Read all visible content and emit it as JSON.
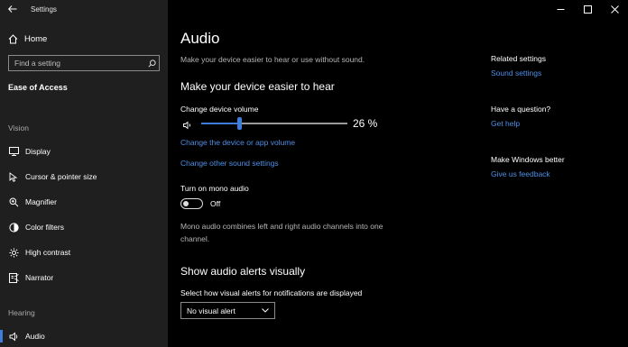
{
  "window": {
    "title": "Settings"
  },
  "sidebar": {
    "home_label": "Home",
    "search_placeholder": "Find a setting",
    "section_title": "Ease of Access",
    "groups": {
      "vision": "Vision",
      "hearing": "Hearing"
    },
    "items": [
      {
        "label": "Display",
        "icon": "monitor-icon"
      },
      {
        "label": "Cursor & pointer size",
        "icon": "cursor-icon"
      },
      {
        "label": "Magnifier",
        "icon": "magnifier-icon"
      },
      {
        "label": "Color filters",
        "icon": "color-filter-icon"
      },
      {
        "label": "High contrast",
        "icon": "contrast-icon"
      },
      {
        "label": "Narrator",
        "icon": "narrator-icon"
      },
      {
        "label": "Audio",
        "icon": "speaker-icon",
        "active": true
      }
    ]
  },
  "main": {
    "title": "Audio",
    "subtitle": "Make your device easier to hear or use without sound.",
    "section1_heading": "Make your device easier to hear",
    "volume_label": "Change device volume",
    "volume": {
      "value": 26,
      "display": "26 %"
    },
    "link_app_volume": "Change the device or app volume",
    "link_sound_settings": "Change other sound settings",
    "mono_label": "Turn on mono audio",
    "mono_state": "Off",
    "mono_description": "Mono audio combines left and right audio channels into one channel.",
    "section2_heading": "Show audio alerts visually",
    "alerts_label": "Select how visual alerts for notifications are displayed",
    "alerts_value": "No visual alert"
  },
  "related": {
    "related_heading": "Related settings",
    "sound_settings_link": "Sound settings",
    "question_heading": "Have a question?",
    "help_link": "Get help",
    "feedback_heading": "Make Windows better",
    "feedback_link": "Give us feedback"
  },
  "colors": {
    "accent": "#3e7ddb",
    "link": "#4f8fe6",
    "sidebar_bg": "#1f1f1f",
    "main_bg": "#000000"
  }
}
